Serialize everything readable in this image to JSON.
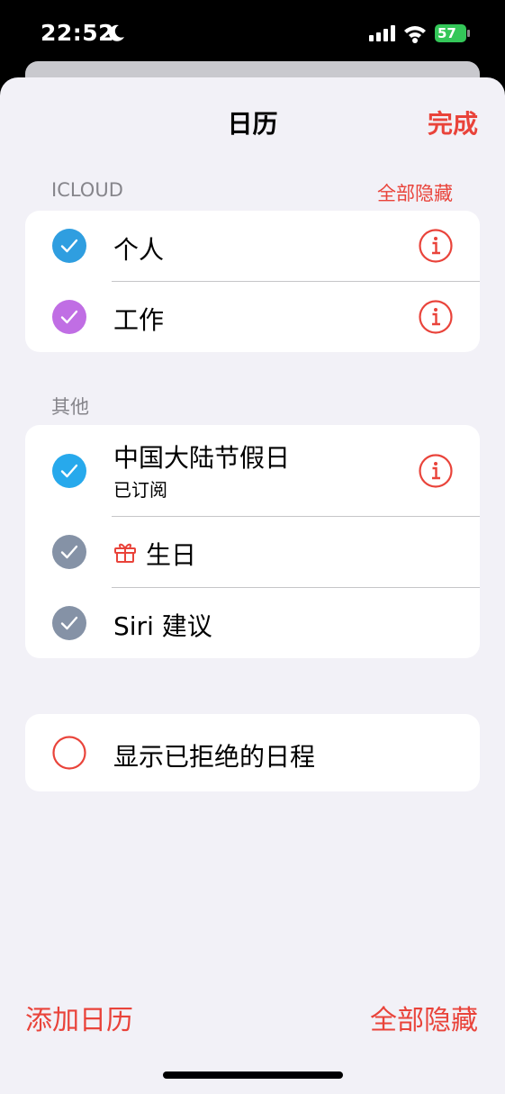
{
  "status_bar": {
    "time": "22:52",
    "battery": "57"
  },
  "header": {
    "title": "日历",
    "done_label": "完成"
  },
  "icloud_section": {
    "label": "ICLOUD",
    "action": "全部隐藏",
    "items": [
      {
        "label": "个人",
        "color": "#2f9ee0"
      },
      {
        "label": "工作",
        "color": "#c06ee4"
      }
    ]
  },
  "other_section": {
    "label": "其他",
    "items": [
      {
        "label": "中国大陆节假日",
        "sublabel": "已订阅",
        "color": "#27a9ec"
      },
      {
        "label": "生日",
        "color": "#8592a6"
      },
      {
        "label": "Siri 建议",
        "color": "#8592a6"
      }
    ]
  },
  "declined": {
    "label": "显示已拒绝的日程"
  },
  "footer": {
    "add_calendar": "添加日历",
    "hide_all": "全部隐藏"
  },
  "colors": {
    "accent": "#e9433a",
    "background": "#f2f1f7",
    "separator": "#c6c6c8"
  }
}
